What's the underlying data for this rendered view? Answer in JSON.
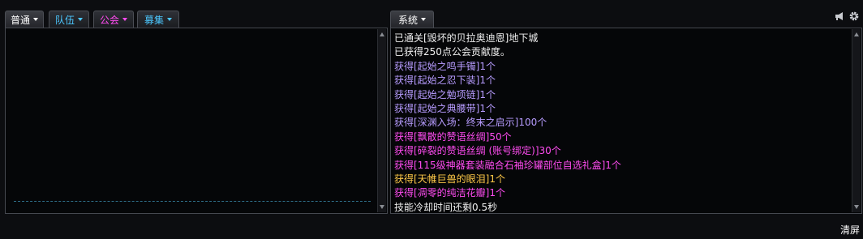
{
  "colors": {
    "white": "#f0f0f0",
    "purple": "#b79cff",
    "pink": "#ff4cf1",
    "gold": "#ffc948",
    "tab_team": "#4cc7ff",
    "tab_guild": "#ff4cf1",
    "tab_recruit": "#4cc7ff"
  },
  "left_tabs": [
    {
      "label": "普通",
      "active": true,
      "color": "#ffffff"
    },
    {
      "label": "队伍",
      "active": false,
      "color": "#4cc7ff"
    },
    {
      "label": "公会",
      "active": false,
      "color": "#ff4cf1"
    },
    {
      "label": "募集",
      "active": false,
      "color": "#4cc7ff"
    }
  ],
  "right_tab": {
    "label": "系统",
    "active": true,
    "color": "#ffffff"
  },
  "icons": {
    "speaker": "megaphone-icon",
    "settings": "gear-icon"
  },
  "system_messages": [
    {
      "text": "已通关[毁坏的贝拉奥迪恩]地下城",
      "color": "#f0f0f0"
    },
    {
      "text": "已获得250点公会贡献度。",
      "color": "#f0f0f0"
    },
    {
      "text": "获得[起始之鸣手镯]1个",
      "color": "#b79cff"
    },
    {
      "text": "获得[起始之忍下装]1个",
      "color": "#b79cff"
    },
    {
      "text": "获得[起始之勉项链]1个",
      "color": "#b79cff"
    },
    {
      "text": "获得[起始之典腰带]1个",
      "color": "#b79cff"
    },
    {
      "text": "获得[深渊入场：终末之启示]100个",
      "color": "#b79cff"
    },
    {
      "text": "获得[飘散的赞语丝绸]50个",
      "color": "#ff4cf1"
    },
    {
      "text": "获得[碎裂的赞语丝绸 (账号绑定)]30个",
      "color": "#ff4cf1"
    },
    {
      "text": "获得[115级神器套装融合石袖珍罐部位自选礼盒]1个",
      "color": "#ff4cf1"
    },
    {
      "text": "获得[天帷巨兽的眼泪]1个",
      "color": "#ffc948"
    },
    {
      "text": "获得[凋零的纯洁花瓣]1个",
      "color": "#ff4cf1"
    },
    {
      "text": "技能冷却时间还剩0.5秒",
      "color": "#f0f0f0"
    }
  ],
  "clear_button": "清屏"
}
